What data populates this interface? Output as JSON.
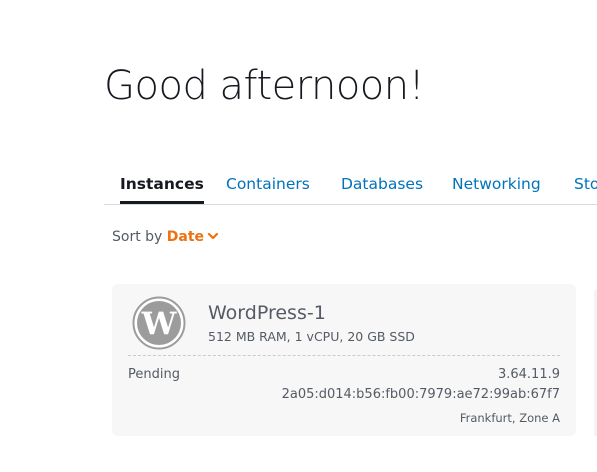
{
  "header": {
    "greeting": "Good afternoon!"
  },
  "tabs": [
    {
      "label": "Instances",
      "active": true
    },
    {
      "label": "Containers",
      "active": false
    },
    {
      "label": "Databases",
      "active": false
    },
    {
      "label": "Networking",
      "active": false
    },
    {
      "label": "Sto",
      "active": false
    }
  ],
  "sort": {
    "label": "Sort by",
    "value": "Date",
    "icon": "chevron-down-icon"
  },
  "instance": {
    "name": "WordPress-1",
    "spec": "512 MB RAM, 1 vCPU, 20 GB SSD",
    "status": "Pending",
    "ipv4": "3.64.11.9",
    "ipv6": "2a05:d014:b56:fb00:7979:ae72:99ab:67f7",
    "region": "Frankfurt, Zone A",
    "icon": "wordpress-logo-icon"
  },
  "colors": {
    "accent_orange": "#ec7211",
    "link_blue": "#0073bb",
    "text_dark": "#16191f",
    "text_muted": "#545b64",
    "card_bg": "#f7f7f7",
    "logo_gray": "#9c9c9c"
  }
}
